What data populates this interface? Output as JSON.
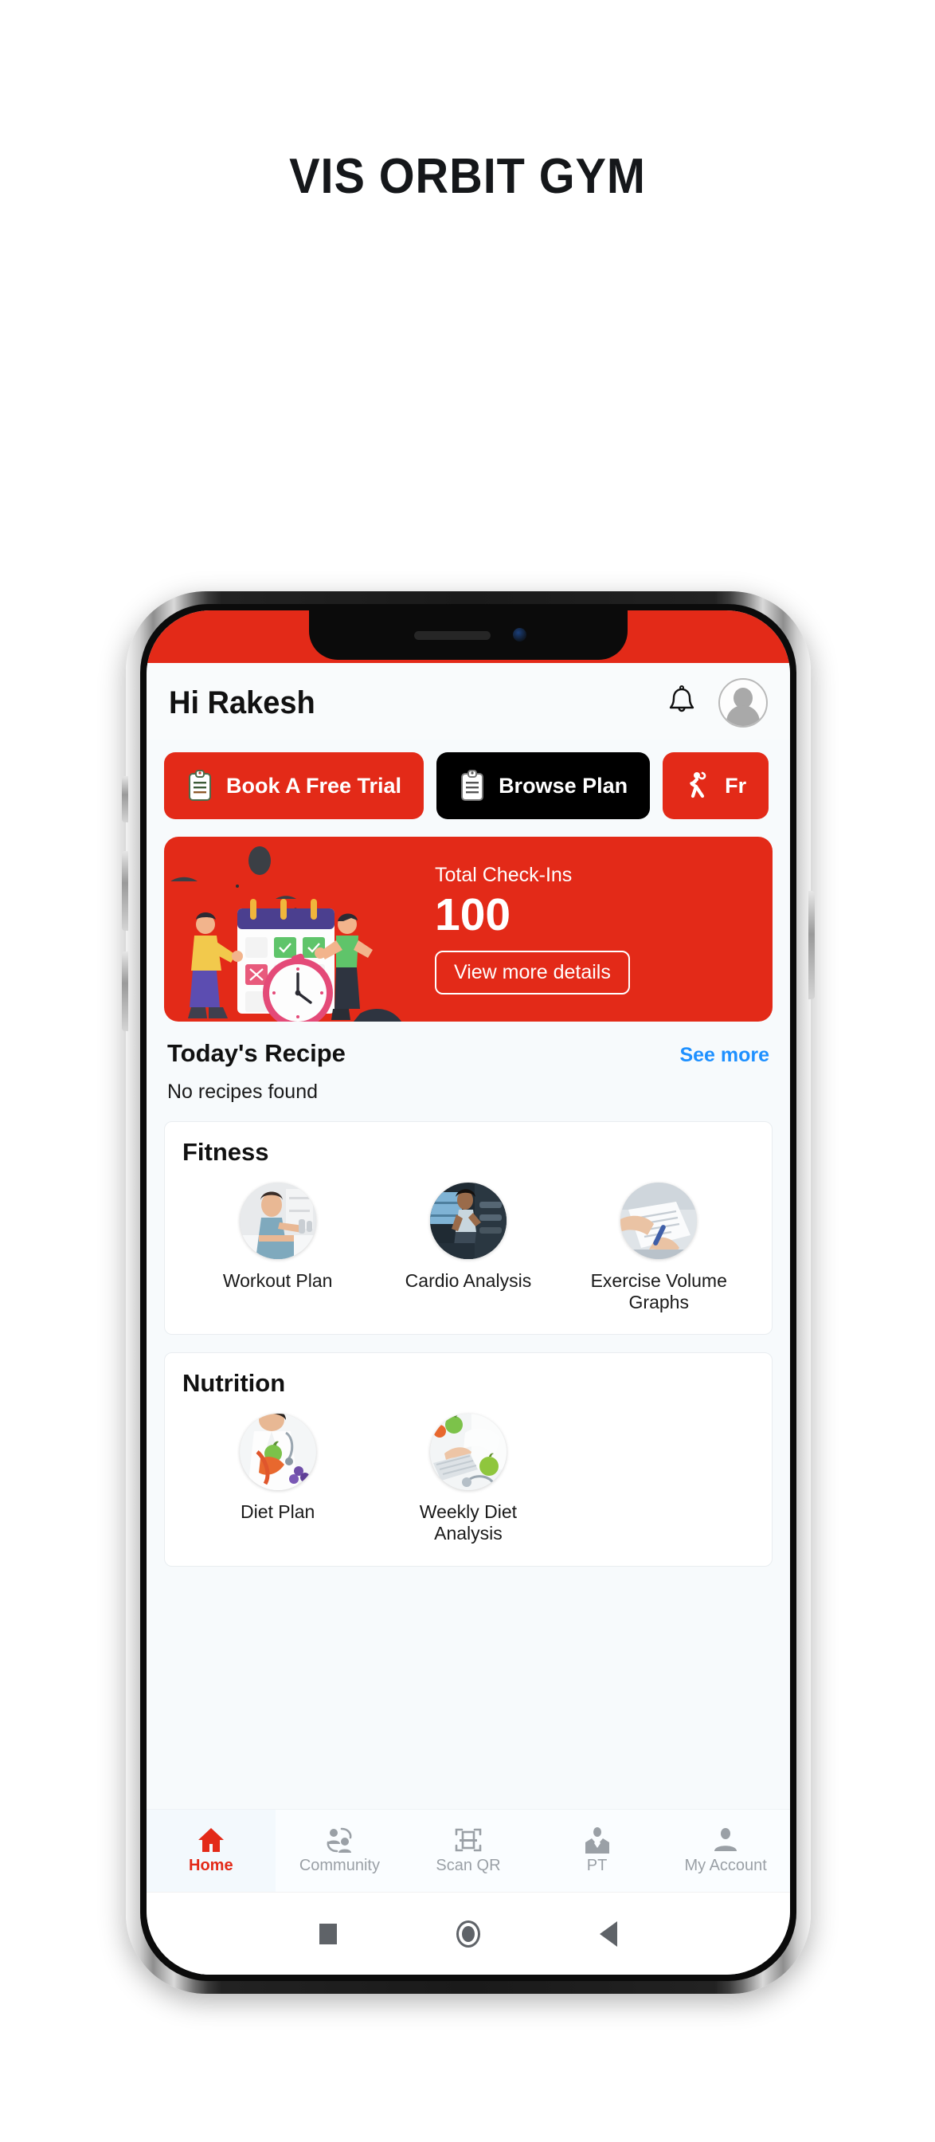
{
  "page": {
    "title": "VIS ORBIT GYM"
  },
  "app": {
    "header": {
      "greeting": "Hi Rakesh",
      "notification_icon": "bell-icon",
      "avatar_icon": "user-avatar-icon"
    },
    "quick_actions": [
      {
        "label": "Book A Free Trial",
        "icon": "clipboard-icon",
        "style": "red"
      },
      {
        "label": "Browse Plan",
        "icon": "clipboard-icon",
        "style": "black"
      },
      {
        "label": "Fr",
        "icon": "dancing-person-icon",
        "style": "red"
      }
    ],
    "checkin_card": {
      "label": "Total Check-Ins",
      "value": "100",
      "button_label": "View more details",
      "illustration": "calendar-clock-people-illustration",
      "bg_color": "#e32a18"
    },
    "recipe": {
      "title": "Today's Recipe",
      "see_more": "See more",
      "empty_text": "No recipes found"
    },
    "sections": [
      {
        "title": "Fitness",
        "items": [
          {
            "label": "Workout Plan",
            "icon": "woman-dumbbell-photo"
          },
          {
            "label": "Cardio Analysis",
            "icon": "treadmill-running-photo"
          },
          {
            "label": "Exercise Volume Graphs",
            "icon": "hands-notebook-photo"
          }
        ]
      },
      {
        "title": "Nutrition",
        "items": [
          {
            "label": "Diet Plan",
            "icon": "dietitian-apple-photo"
          },
          {
            "label": "Weekly Diet Analysis",
            "icon": "laptop-apple-photo"
          }
        ]
      }
    ],
    "bottom_nav": [
      {
        "label": "Home",
        "icon": "home-icon",
        "active": true
      },
      {
        "label": "Community",
        "icon": "community-icon",
        "active": false
      },
      {
        "label": "Scan QR",
        "icon": "scan-qr-icon",
        "active": false
      },
      {
        "label": "PT",
        "icon": "trainer-icon",
        "active": false
      },
      {
        "label": "My Account",
        "icon": "person-icon",
        "active": false
      }
    ],
    "accent_color": "#e32a18",
    "link_color": "#1e90ff"
  },
  "system_bar": {
    "recents_icon": "square-icon",
    "home_icon": "circle-icon",
    "back_icon": "triangle-back-icon"
  }
}
